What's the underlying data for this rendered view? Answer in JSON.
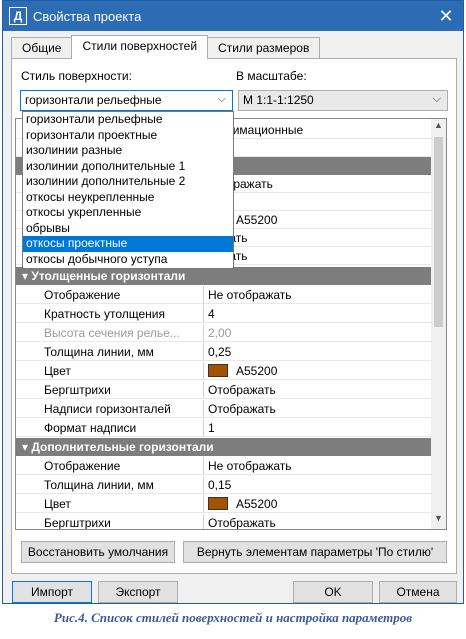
{
  "window": {
    "title": "Свойства проекта",
    "icon_letter": "Д"
  },
  "tabs": [
    {
      "label": "Общие"
    },
    {
      "label": "Стили поверхностей"
    },
    {
      "label": "Стили размеров"
    }
  ],
  "surface_style": {
    "label": "Стиль поверхности:",
    "value": "горизонтали рельефные"
  },
  "scale": {
    "label": "В масштабе:",
    "value": "М 1:1-1:1250"
  },
  "dropdown": {
    "items": [
      "горизонтали рельефные",
      "горизонтали проектные",
      "изолинии разные",
      "изолинии дополнительные 1",
      "изолинии дополнительные 2",
      "откосы неукрепленные",
      "откосы укрепленные",
      "обрывы",
      "откосы проектные",
      "откосы добычного уступа"
    ],
    "selected_index": 8
  },
  "grid_hidden_fragments": {
    "r1": "роксимационные",
    "r2": "отображать",
    "r3": "A55200",
    "r4": "ражать",
    "r5": "ражать"
  },
  "categories": {
    "thick": {
      "title": "Утолщенные горизонтали",
      "rows": [
        {
          "name": "Отображение",
          "value": "Не отображать"
        },
        {
          "name": "Кратность утолщения",
          "value": "4"
        },
        {
          "name": "Высота сечения релье...",
          "value": "2,00"
        },
        {
          "name": "Толщина линии, мм",
          "value": "0,25"
        },
        {
          "name": "Цвет",
          "value": "A55200"
        },
        {
          "name": "Бергштрихи",
          "value": "Отображать"
        },
        {
          "name": "Надписи горизонталей",
          "value": "Отображать"
        },
        {
          "name": "Формат надписи",
          "value": "1"
        }
      ]
    },
    "extra": {
      "title": "Дополнительные горизонтали",
      "rows": [
        {
          "name": "Отображение",
          "value": "Не отображать"
        },
        {
          "name": "Толщина линии, мм",
          "value": "0,15"
        },
        {
          "name": "Цвет",
          "value": "A55200"
        },
        {
          "name": "Бергштрихи",
          "value": "Отображать"
        }
      ]
    }
  },
  "color_swatch": "#A55200",
  "buttons": {
    "restore": "Восстановить умолчания",
    "by_style": "Вернуть элементам параметры 'По стилю'",
    "import": "Импорт",
    "export": "Экспорт",
    "ok": "OK",
    "cancel": "Отмена"
  },
  "caption": "Рис.4. Список стилей поверхностей и настройка параметров"
}
